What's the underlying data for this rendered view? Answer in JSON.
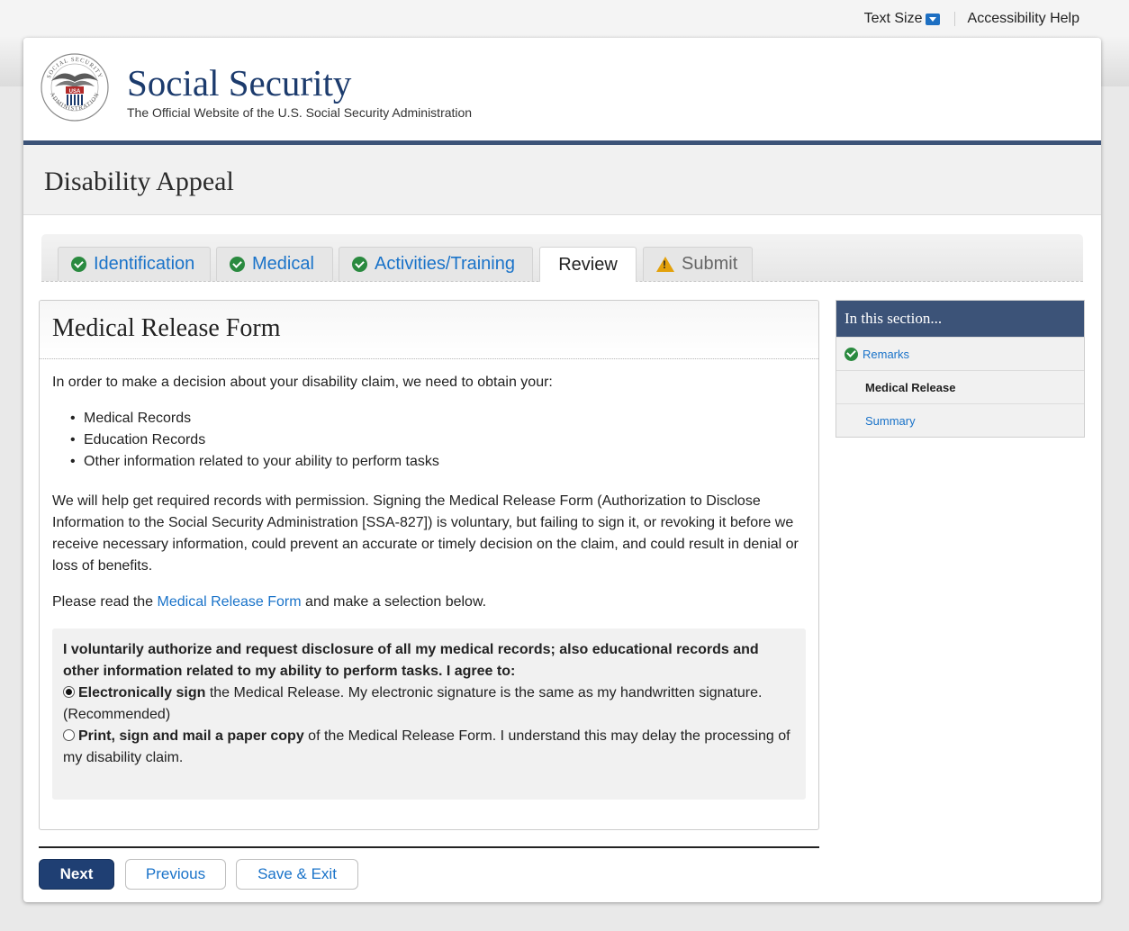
{
  "utility": {
    "text_size": "Text Size",
    "accessibility_help": "Accessibility Help"
  },
  "header": {
    "brand": "Social Security",
    "tagline": "The Official Website of the U.S. Social Security Administration"
  },
  "page_title": "Disability Appeal",
  "tabs": [
    {
      "label": "Identification",
      "status": "complete"
    },
    {
      "label": "Medical",
      "status": "complete"
    },
    {
      "label": "Activities/Training",
      "status": "complete"
    },
    {
      "label": "Review",
      "status": "current"
    },
    {
      "label": "Submit",
      "status": "warning"
    }
  ],
  "form": {
    "title": "Medical Release Form",
    "intro": "In order to make a decision about your disability claim, we need to obtain your:",
    "records": [
      "Medical Records",
      "Education Records",
      "Other information related to your ability to perform tasks"
    ],
    "paragraph": "We will help get required records with permission. Signing the Medical Release Form (Authorization to Disclose Information to the Social Security Administration [SSA-827]) is voluntary, but failing to sign it, or revoking it before we receive necessary information, could prevent an accurate or timely decision on the claim, and could result in denial or loss of benefits.",
    "read_prefix": "Please read the ",
    "read_link": "Medical Release Form",
    "read_suffix": " and make a selection below.",
    "question": "I voluntarily authorize and request disclosure of all my medical records; also educational records and other information related to my ability to perform tasks. I agree to:",
    "options": [
      {
        "bold": "Electronically sign",
        "rest": " the Medical Release. My electronic signature is the same as my handwritten signature. (Recommended)",
        "selected": true
      },
      {
        "bold": "Print, sign and mail a paper copy",
        "rest": " of the Medical Release Form. I understand this may delay the processing of my disability claim.",
        "selected": false
      }
    ]
  },
  "sidebar": {
    "heading": "In this section...",
    "items": [
      {
        "label": "Remarks",
        "state": "complete"
      },
      {
        "label": "Medical Release",
        "state": "current"
      },
      {
        "label": "Summary",
        "state": "link"
      }
    ]
  },
  "buttons": {
    "next": "Next",
    "previous": "Previous",
    "save_exit": "Save & Exit"
  },
  "colors": {
    "brand_navy": "#1c3b6d",
    "accent_blue": "#1a73c9",
    "complete_green": "#2a8a3f",
    "warning_amber": "#e3a10b"
  }
}
